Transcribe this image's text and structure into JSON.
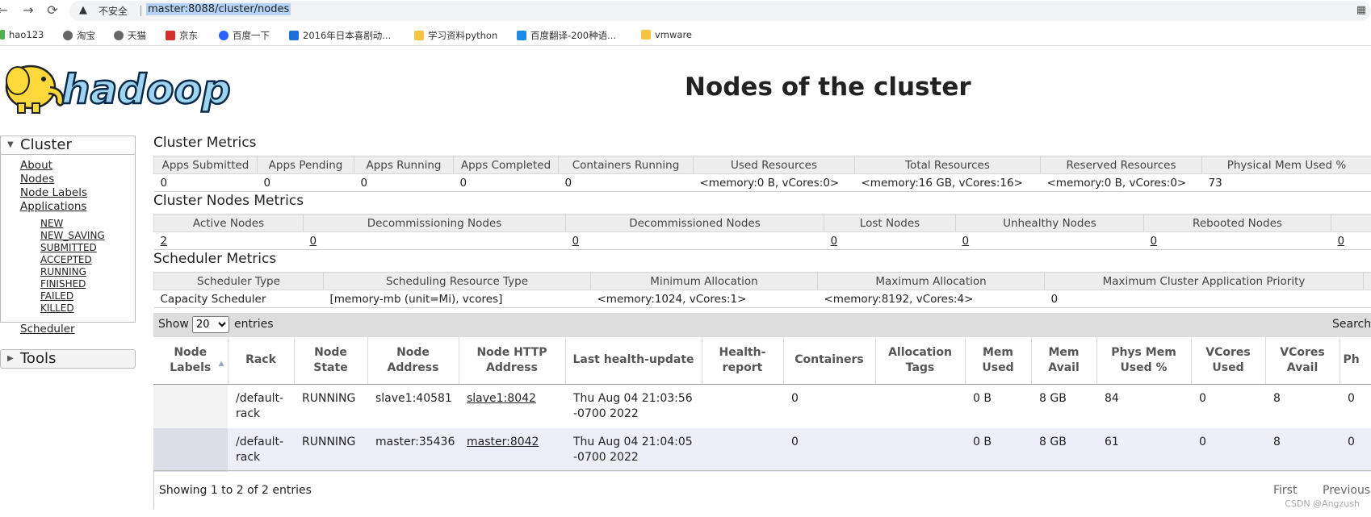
{
  "browser": {
    "back": "←",
    "forward": "→",
    "reload": "⟳",
    "insecure_label": "不安全",
    "url": "master:8088/cluster/nodes",
    "bookmarks": [
      {
        "label": "hao123",
        "color": "#4caf50"
      },
      {
        "label": "淘宝",
        "color": "#555"
      },
      {
        "label": "天猫",
        "color": "#555"
      },
      {
        "label": "京东",
        "color": "#d32f2f"
      },
      {
        "label": "百度一下",
        "color": "#2962ff"
      },
      {
        "label": "2016年日本喜剧动...",
        "color": "#1e6fd9"
      },
      {
        "label": "学习资料python",
        "color": "#f5c542"
      },
      {
        "label": "百度翻译-200种语...",
        "color": "#1e88e5"
      },
      {
        "label": "vmware",
        "color": "#f5c542"
      }
    ]
  },
  "header": {
    "logo_text": "hadoop",
    "title": "Nodes of the cluster"
  },
  "sidebar": {
    "cluster_heading": "Cluster",
    "links": [
      "About",
      "Nodes",
      "Node Labels",
      "Applications"
    ],
    "app_states": [
      "NEW",
      "NEW_SAVING",
      "SUBMITTED",
      "ACCEPTED",
      "RUNNING",
      "FINISHED",
      "FAILED",
      "KILLED"
    ],
    "scheduler": "Scheduler",
    "tools_heading": "Tools"
  },
  "cluster_metrics": {
    "title": "Cluster Metrics",
    "headers": [
      "Apps Submitted",
      "Apps Pending",
      "Apps Running",
      "Apps Completed",
      "Containers Running",
      "Used Resources",
      "Total Resources",
      "Reserved Resources",
      "Physical Mem Used %"
    ],
    "values": [
      "0",
      "0",
      "0",
      "0",
      "0",
      "<memory:0 B, vCores:0>",
      "<memory:16 GB, vCores:16>",
      "<memory:0 B, vCores:0>",
      "73"
    ]
  },
  "nodes_metrics": {
    "title": "Cluster Nodes Metrics",
    "headers": [
      "Active Nodes",
      "Decommissioning Nodes",
      "Decommissioned Nodes",
      "Lost Nodes",
      "Unhealthy Nodes",
      "Rebooted Nodes"
    ],
    "values": [
      "2",
      "0",
      "0",
      "0",
      "0",
      "0",
      "0"
    ]
  },
  "scheduler_metrics": {
    "title": "Scheduler Metrics",
    "headers": [
      "Scheduler Type",
      "Scheduling Resource Type",
      "Minimum Allocation",
      "Maximum Allocation",
      "Maximum Cluster Application Priority"
    ],
    "values": [
      "Capacity Scheduler",
      "[memory-mb (unit=Mi), vcores]",
      "<memory:1024, vCores:1>",
      "<memory:8192, vCores:4>",
      "0"
    ]
  },
  "table_controls": {
    "show": "Show",
    "page_size": "20",
    "entries": "entries",
    "search": "Search:"
  },
  "nodes_table": {
    "headers": [
      "Node Labels",
      "Rack",
      "Node State",
      "Node Address",
      "Node HTTP Address",
      "Last health-update",
      "Health-report",
      "Containers",
      "Allocation Tags",
      "Mem Used",
      "Mem Avail",
      "Phys Mem Used %",
      "VCores Used",
      "VCores Avail",
      "Ph"
    ],
    "rows": [
      [
        "",
        "/default-rack",
        "RUNNING",
        "slave1:40581",
        "slave1:8042",
        "Thu Aug 04 21:03:56 -0700 2022",
        "",
        "0",
        "",
        "0 B",
        "8 GB",
        "84",
        "0",
        "8",
        "0"
      ],
      [
        "",
        "/default-rack",
        "RUNNING",
        "master:35436",
        "master:8042",
        "Thu Aug 04 21:04:05 -0700 2022",
        "",
        "0",
        "",
        "0 B",
        "8 GB",
        "61",
        "0",
        "8",
        "0"
      ]
    ]
  },
  "footer": {
    "info": "Showing 1 to 2 of 2 entries",
    "first": "First",
    "previous": "Previous",
    "watermark": "CSDN @Angzush"
  }
}
